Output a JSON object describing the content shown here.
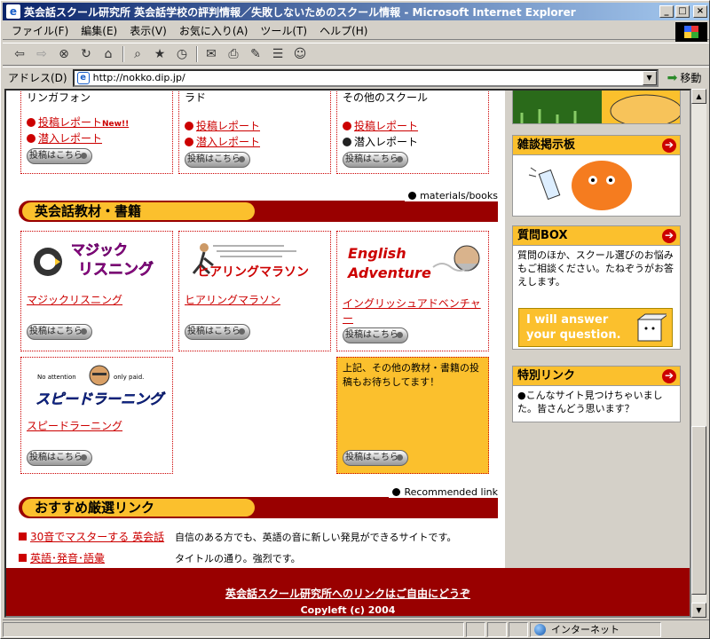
{
  "window": {
    "title": "英会話スクール研究所 英会話学校の評判情報／失敗しないためのスクール情報 - Microsoft Internet Explorer",
    "minimize": "_",
    "maximize": "□",
    "close": "×"
  },
  "menu": [
    "ファイル(F)",
    "編集(E)",
    "表示(V)",
    "お気に入り(A)",
    "ツール(T)",
    "ヘルプ(H)"
  ],
  "toolbar_icons": [
    "back-icon",
    "forward-icon",
    "stop-icon",
    "refresh-icon",
    "home-icon",
    "search-icon",
    "favorites-icon",
    "history-icon",
    "mail-icon",
    "print-icon",
    "edit-icon",
    "discuss-icon",
    "messenger-icon"
  ],
  "address": {
    "label": "アドレス(D)",
    "url": "http://nokko.dip.jp/",
    "go": "移動"
  },
  "top_cards": [
    {
      "name_partial": "リンガフォン",
      "links": [
        {
          "text": "投稿レポート",
          "badge": "New!!",
          "linked": true
        },
        {
          "text": "潜入レポート",
          "badge": "",
          "linked": true
        }
      ],
      "button": "投稿はこちら"
    },
    {
      "name_partial": "ラド",
      "links": [
        {
          "text": "投稿レポート",
          "badge": "",
          "linked": true
        },
        {
          "text": "潜入レポート",
          "badge": "",
          "linked": true
        }
      ],
      "button": "投稿はこちら"
    },
    {
      "name_partial": "その他のスクール",
      "links": [
        {
          "text": "投稿レポート",
          "badge": "",
          "linked": true
        },
        {
          "text": "潜入レポート",
          "badge": "",
          "linked": false
        }
      ],
      "button": "投稿はこちら"
    }
  ],
  "materials": {
    "heading": "英会話教材・書籍",
    "note": "materials/books",
    "items": [
      {
        "logo": "マジック リスニング",
        "link": "マジックリスニング",
        "button": "投稿はこちら"
      },
      {
        "logo": "ヒアリングマラソン",
        "link": "ヒアリングマラソン",
        "button": "投稿はこちら"
      },
      {
        "logo": "English Adventure",
        "link": "イングリッシュアドベンチャー",
        "button": "投稿はこちら"
      },
      {
        "logo": "スピードラーニング",
        "logo_caption_left": "No attention",
        "logo_caption_right": "only paid.",
        "link": "スピードラーニング",
        "button": "投稿はこちら"
      }
    ],
    "request_text": "上記、その他の教材・書籍の投稿もお待ちしてます！",
    "request_button": "投稿はこちら"
  },
  "recommended": {
    "heading": "おすすめ厳選リンク",
    "note": "Recommended link",
    "links": [
      {
        "text": "30音でマスターする 英会話",
        "desc": "自信のある方でも、英語の音に新しい発見ができるサイトです。"
      },
      {
        "text": "英語･発音･語彙",
        "desc": "タイトルの通り。強烈です。"
      }
    ]
  },
  "footer": {
    "link": "英会話スクール研究所へのリンクはご自由にどうぞ",
    "copyright": "Copyleft (c) 2004"
  },
  "sidebar": {
    "bbs": {
      "title": "雑談掲示板"
    },
    "qa": {
      "title": "質問BOX",
      "body": "質問のほか、スクール選びのお悩みもご相談ください。たねぞうがお答えします。",
      "banner": "I will answer your question."
    },
    "special": {
      "title": "特別リンク",
      "body": "●こんなサイト見つけちゃいました。皆さんどう思います？"
    }
  },
  "status": {
    "zone": "インターネット"
  },
  "colors": {
    "accent": "#990000",
    "yellow": "#fbc02d",
    "link": "#cc0000"
  }
}
